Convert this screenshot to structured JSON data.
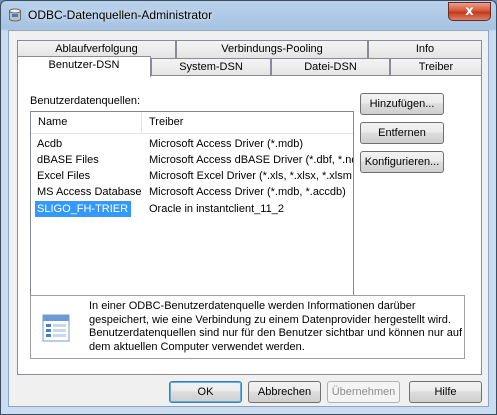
{
  "window": {
    "title": "ODBC-Datenquellen-Administrator",
    "close_label": "x"
  },
  "tabs": {
    "row_back": [
      "Ablaufverfolgung",
      "Verbindungs-Pooling",
      "Info"
    ],
    "row_front": [
      "Benutzer-DSN",
      "System-DSN",
      "Datei-DSN",
      "Treiber"
    ],
    "active": "Benutzer-DSN"
  },
  "panel": {
    "list_label": "Benutzerdatenquellen:",
    "columns": [
      "Name",
      "Treiber"
    ],
    "rows": [
      {
        "name": "Acdb",
        "driver": "Microsoft Access Driver (*.mdb)"
      },
      {
        "name": "dBASE Files",
        "driver": "Microsoft Access dBASE Driver (*.dbf, *.ndx"
      },
      {
        "name": "Excel Files",
        "driver": "Microsoft Excel Driver (*.xls, *.xlsx, *.xlsm"
      },
      {
        "name": "MS Access Database",
        "driver": "Microsoft Access Driver (*.mdb, *.accdb)"
      },
      {
        "name": "SLIGO_FH-TRIER",
        "driver": "Oracle in instantclient_11_2"
      }
    ],
    "selected_index": 4,
    "buttons": {
      "add": "Hinzufügen...",
      "remove": "Entfernen",
      "configure": "Konfigurieren..."
    },
    "info_text": "In einer ODBC-Benutzerdatenquelle werden Informationen darüber gespeichert, wie eine Verbindung zu einem Datenprovider hergestellt wird. Benutzerdatenquellen sind nur für den Benutzer sichtbar und können nur auf dem aktuellen Computer verwendet werden."
  },
  "dialog_buttons": {
    "ok": "OK",
    "cancel": "Abbrechen",
    "apply": "Übernehmen",
    "help": "Hilfe"
  },
  "icons": {
    "title": "odbc-database-icon",
    "info": "datasource-info-icon"
  }
}
